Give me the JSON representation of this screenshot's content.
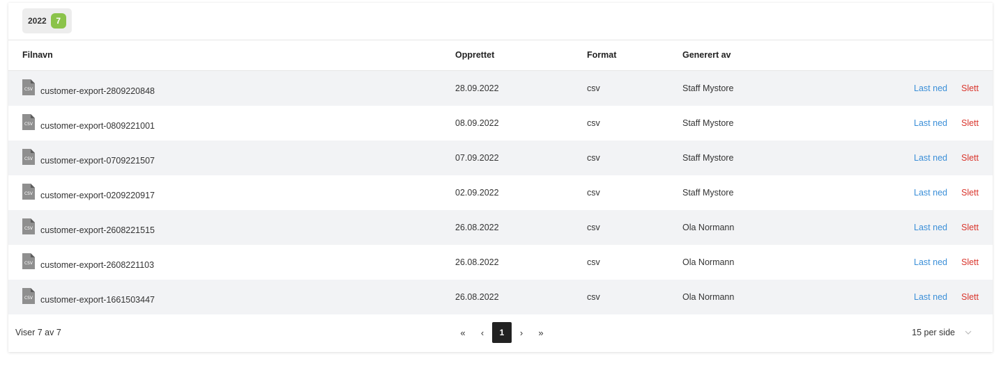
{
  "year_filter": {
    "year": "2022",
    "count": "7"
  },
  "columns": {
    "filename": "Filnavn",
    "created": "Opprettet",
    "format": "Format",
    "generated_by": "Generert av"
  },
  "icons": {
    "file": "csv-file-icon",
    "chevron": "chevron-down-icon"
  },
  "rows": [
    {
      "icon_text": "CSV",
      "filename": "customer-export-2809220848",
      "created": "28.09.2022",
      "format": "csv",
      "generated_by": "Staff Mystore",
      "download": "Last ned",
      "delete": "Slett"
    },
    {
      "icon_text": "CSV",
      "filename": "customer-export-0809221001",
      "created": "08.09.2022",
      "format": "csv",
      "generated_by": "Staff Mystore",
      "download": "Last ned",
      "delete": "Slett"
    },
    {
      "icon_text": "CSV",
      "filename": "customer-export-0709221507",
      "created": "07.09.2022",
      "format": "csv",
      "generated_by": "Staff Mystore",
      "download": "Last ned",
      "delete": "Slett"
    },
    {
      "icon_text": "CSV",
      "filename": "customer-export-0209220917",
      "created": "02.09.2022",
      "format": "csv",
      "generated_by": "Staff Mystore",
      "download": "Last ned",
      "delete": "Slett"
    },
    {
      "icon_text": "CSV",
      "filename": "customer-export-2608221515",
      "created": "26.08.2022",
      "format": "csv",
      "generated_by": "Ola Normann",
      "download": "Last ned",
      "delete": "Slett"
    },
    {
      "icon_text": "CSV",
      "filename": "customer-export-2608221103",
      "created": "26.08.2022",
      "format": "csv",
      "generated_by": "Ola Normann",
      "download": "Last ned",
      "delete": "Slett"
    },
    {
      "icon_text": "CSV",
      "filename": "customer-export-1661503447",
      "created": "26.08.2022",
      "format": "csv",
      "generated_by": "Ola Normann",
      "download": "Last ned",
      "delete": "Slett"
    }
  ],
  "footer": {
    "info": "Viser 7 av 7",
    "pager": {
      "first": "«",
      "prev": "‹",
      "current": "1",
      "next": "›",
      "last": "»"
    },
    "per_page": "15 per side"
  },
  "colors": {
    "accent_badge": "#8bc34a",
    "link": "#3b8fd8",
    "danger": "#d9342b",
    "row_alt": "#f2f3f5"
  }
}
